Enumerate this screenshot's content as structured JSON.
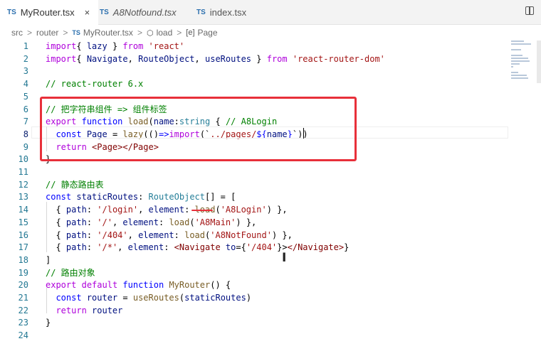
{
  "tabs": [
    {
      "type": "TS",
      "label": "MyRouter.tsx",
      "close": "×"
    },
    {
      "type": "TS",
      "label": "A8Notfound.tsx"
    },
    {
      "type": "TS",
      "label": "index.tsx"
    }
  ],
  "breadcrumb": {
    "items": [
      "src",
      "router",
      "MyRouter.tsx",
      "load",
      "Page"
    ],
    "file_type": "TS",
    "sym_fn": "⬡",
    "sym_var": "[e]",
    "separator": ">"
  },
  "lines": [
    {
      "n": "1",
      "c": [
        [
          "kw2",
          "import"
        ],
        [
          "",
          "{ "
        ],
        [
          "var",
          "lazy"
        ],
        [
          "",
          " } "
        ],
        [
          "kw2",
          "from"
        ],
        [
          "",
          " "
        ],
        [
          "str",
          "'react'"
        ]
      ]
    },
    {
      "n": "2",
      "c": [
        [
          "kw2",
          "import"
        ],
        [
          "",
          "{ "
        ],
        [
          "var",
          "Navigate"
        ],
        [
          "",
          ", "
        ],
        [
          "var",
          "RouteObject"
        ],
        [
          "",
          ", "
        ],
        [
          "var",
          "useRoutes"
        ],
        [
          "",
          " } "
        ],
        [
          "kw2",
          "from"
        ],
        [
          "",
          " "
        ],
        [
          "str",
          "'react-router-dom'"
        ]
      ]
    },
    {
      "n": "3",
      "c": []
    },
    {
      "n": "4",
      "c": [
        [
          "cmt",
          "// react-router 6.x"
        ]
      ]
    },
    {
      "n": "5",
      "c": []
    },
    {
      "n": "6",
      "c": [
        [
          "cmt",
          "// 把字符串组件 => 组件标签"
        ]
      ]
    },
    {
      "n": "7",
      "c": [
        [
          "kw2",
          "export"
        ],
        [
          "",
          " "
        ],
        [
          "kw",
          "function"
        ],
        [
          "",
          " "
        ],
        [
          "fn",
          "load"
        ],
        [
          "",
          "("
        ],
        [
          "var",
          "name"
        ],
        [
          "",
          ":"
        ],
        [
          "type",
          "string"
        ],
        [
          "",
          " { "
        ],
        [
          "cmt",
          "// A8Login"
        ]
      ]
    },
    {
      "n": "8",
      "c": [
        [
          "",
          ""
        ],
        [
          "kw",
          "  const"
        ],
        [
          "",
          " "
        ],
        [
          "var",
          "Page"
        ],
        [
          "",
          " = "
        ],
        [
          "fn",
          "lazy"
        ],
        [
          "",
          "(()"
        ],
        [
          "kw",
          "=>"
        ],
        [
          "kw2",
          "import"
        ],
        [
          "",
          "(`"
        ],
        [
          "str",
          "../pages/"
        ],
        [
          "kw",
          "${"
        ],
        [
          "var",
          "name"
        ],
        [
          "kw",
          "}"
        ],
        [
          "",
          "`))"
        ]
      ]
    },
    {
      "n": "9",
      "c": [
        [
          "kw2",
          "  return"
        ],
        [
          "",
          " "
        ],
        [
          "tag",
          "<Page></Page>"
        ]
      ]
    },
    {
      "n": "10",
      "c": [
        [
          "",
          "}"
        ]
      ]
    },
    {
      "n": "11",
      "c": []
    },
    {
      "n": "12",
      "c": [
        [
          "cmt",
          "// 静态路由表"
        ]
      ]
    },
    {
      "n": "13",
      "c": [
        [
          "kw",
          "const"
        ],
        [
          "",
          " "
        ],
        [
          "var",
          "staticRoutes"
        ],
        [
          "",
          ": "
        ],
        [
          "type",
          "RouteObject"
        ],
        [
          "",
          "[] = ["
        ]
      ]
    },
    {
      "n": "14",
      "c": [
        [
          "",
          "  { "
        ],
        [
          "var",
          "path"
        ],
        [
          "",
          ": "
        ],
        [
          "str",
          "'/login'"
        ],
        [
          "",
          ", "
        ],
        [
          "var",
          "element"
        ],
        [
          "",
          ": "
        ],
        [
          "fn",
          "load"
        ],
        [
          "",
          "("
        ],
        [
          "str",
          "'A8Login'"
        ],
        [
          "",
          ") },"
        ]
      ]
    },
    {
      "n": "15",
      "c": [
        [
          "",
          "  { "
        ],
        [
          "var",
          "path"
        ],
        [
          "",
          ": "
        ],
        [
          "str",
          "'/'"
        ],
        [
          "",
          ", "
        ],
        [
          "var",
          "element"
        ],
        [
          "",
          ": "
        ],
        [
          "fn",
          "load"
        ],
        [
          "",
          "("
        ],
        [
          "str",
          "'A8Main'"
        ],
        [
          "",
          ") },"
        ]
      ]
    },
    {
      "n": "16",
      "c": [
        [
          "",
          "  { "
        ],
        [
          "var",
          "path"
        ],
        [
          "",
          ": "
        ],
        [
          "str",
          "'/404'"
        ],
        [
          "",
          ", "
        ],
        [
          "var",
          "element"
        ],
        [
          "",
          ": "
        ],
        [
          "fn",
          "load"
        ],
        [
          "",
          "("
        ],
        [
          "str",
          "'A8NotFound'"
        ],
        [
          "",
          ") },"
        ]
      ]
    },
    {
      "n": "17",
      "c": [
        [
          "",
          "  { "
        ],
        [
          "var",
          "path"
        ],
        [
          "",
          ": "
        ],
        [
          "str",
          "'/*'"
        ],
        [
          "",
          ", "
        ],
        [
          "var",
          "element"
        ],
        [
          "",
          ": "
        ],
        [
          "tag",
          "<Navigate "
        ],
        [
          "var",
          "to"
        ],
        [
          "",
          "={"
        ],
        [
          "str",
          "'/404'"
        ],
        [
          "",
          "}>"
        ],
        [
          "tag",
          "</Navigate>"
        ],
        [
          "",
          "}"
        ]
      ]
    },
    {
      "n": "18",
      "c": [
        [
          "",
          "]"
        ]
      ]
    },
    {
      "n": "19",
      "c": [
        [
          "cmt",
          "// 路由对象"
        ]
      ]
    },
    {
      "n": "20",
      "c": [
        [
          "kw2",
          "export"
        ],
        [
          "",
          " "
        ],
        [
          "kw2",
          "default"
        ],
        [
          "",
          " "
        ],
        [
          "kw",
          "function"
        ],
        [
          "",
          " "
        ],
        [
          "fn",
          "MyRouter"
        ],
        [
          "",
          "() {"
        ]
      ]
    },
    {
      "n": "21",
      "c": [
        [
          "kw",
          "  const"
        ],
        [
          "",
          " "
        ],
        [
          "var",
          "router"
        ],
        [
          "",
          " = "
        ],
        [
          "fn",
          "useRoutes"
        ],
        [
          "",
          "("
        ],
        [
          "var",
          "staticRoutes"
        ],
        [
          "",
          ")"
        ]
      ]
    },
    {
      "n": "22",
      "c": [
        [
          "kw2",
          "  return"
        ],
        [
          "",
          " "
        ],
        [
          "var",
          "router"
        ]
      ]
    },
    {
      "n": "23",
      "c": [
        [
          "",
          "}"
        ]
      ]
    },
    {
      "n": "24",
      "c": []
    }
  ],
  "cursor_line": "8",
  "ibeam_glyph": "I"
}
